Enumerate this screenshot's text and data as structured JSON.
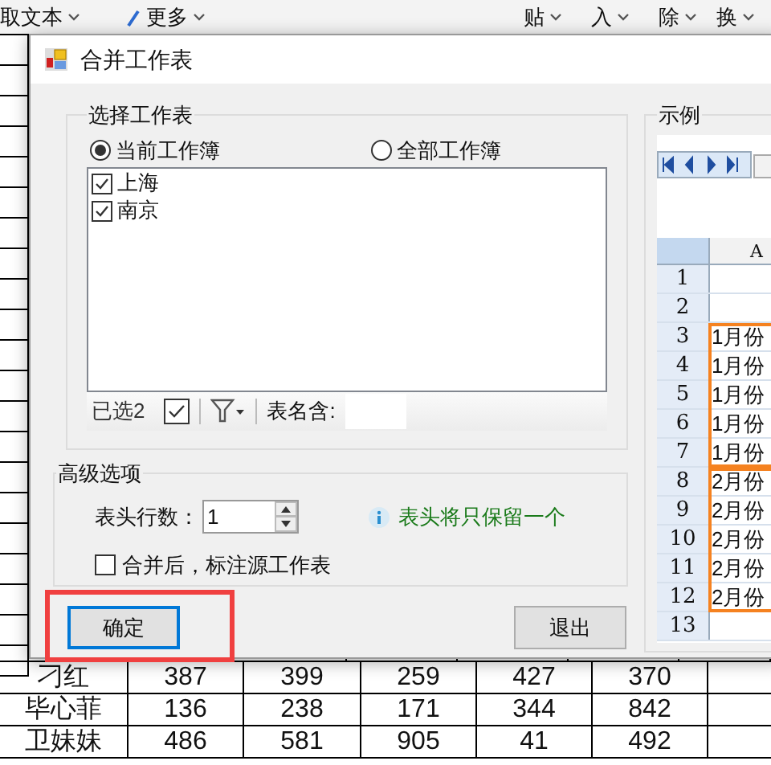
{
  "ribbon": {
    "items": [
      {
        "label": "取文本",
        "kind": "caret"
      },
      {
        "label": "更多",
        "kind": "pencil"
      },
      {
        "label": "贴",
        "kind": "caret"
      },
      {
        "label": "入",
        "kind": "caret"
      },
      {
        "label": "除",
        "kind": "caret"
      },
      {
        "label": "换",
        "kind": "caret"
      }
    ]
  },
  "sheet": {
    "rows": [
      [
        "刁红",
        "387",
        "399",
        "259",
        "427",
        "370"
      ],
      [
        "毕心菲",
        "136",
        "238",
        "171",
        "344",
        "842"
      ],
      [
        "卫妹妹",
        "486",
        "581",
        "905",
        "41",
        "492"
      ]
    ]
  },
  "dialog": {
    "title": "合并工作表",
    "sheet_group": {
      "title": "选择工作表",
      "scope_options": [
        {
          "label": "当前工作簿",
          "selected": true
        },
        {
          "label": "全部工作簿",
          "selected": false
        }
      ],
      "sheets": [
        {
          "label": "上海",
          "checked": true
        },
        {
          "label": "南京",
          "checked": true
        }
      ],
      "selected_count": "已选2",
      "select_all_checked": true,
      "name_filter_label": "表名含:"
    },
    "preview": {
      "title": "示例",
      "column": "A",
      "rows": [
        {
          "kind": "row",
          "number": "1"
        },
        {
          "kind": "row",
          "number": "2"
        },
        {
          "kind": "block",
          "rows": [
            {
              "number": "3",
              "value": "1月份"
            },
            {
              "number": "4",
              "value": "1月份"
            },
            {
              "number": "5",
              "value": "1月份"
            },
            {
              "number": "6",
              "value": "1月份"
            },
            {
              "number": "7",
              "value": "1月份"
            }
          ]
        },
        {
          "kind": "block",
          "rows": [
            {
              "number": "8",
              "value": "2月份"
            },
            {
              "number": "9",
              "value": "2月份"
            },
            {
              "number": "10",
              "value": "2月份"
            },
            {
              "number": "11",
              "value": "2月份"
            },
            {
              "number": "12",
              "value": "2月份"
            }
          ]
        },
        {
          "kind": "row",
          "number": "13"
        }
      ]
    },
    "advanced": {
      "title": "高级选项",
      "header_rows_label": "表头行数：",
      "header_rows_value": "1",
      "hint": "表头将只保留一个",
      "mark_source": {
        "label": "合并后，标注源工作表",
        "checked": false
      }
    },
    "buttons": [
      {
        "label": "确定",
        "focused": true
      },
      {
        "label": "退出",
        "focused": false
      }
    ]
  }
}
